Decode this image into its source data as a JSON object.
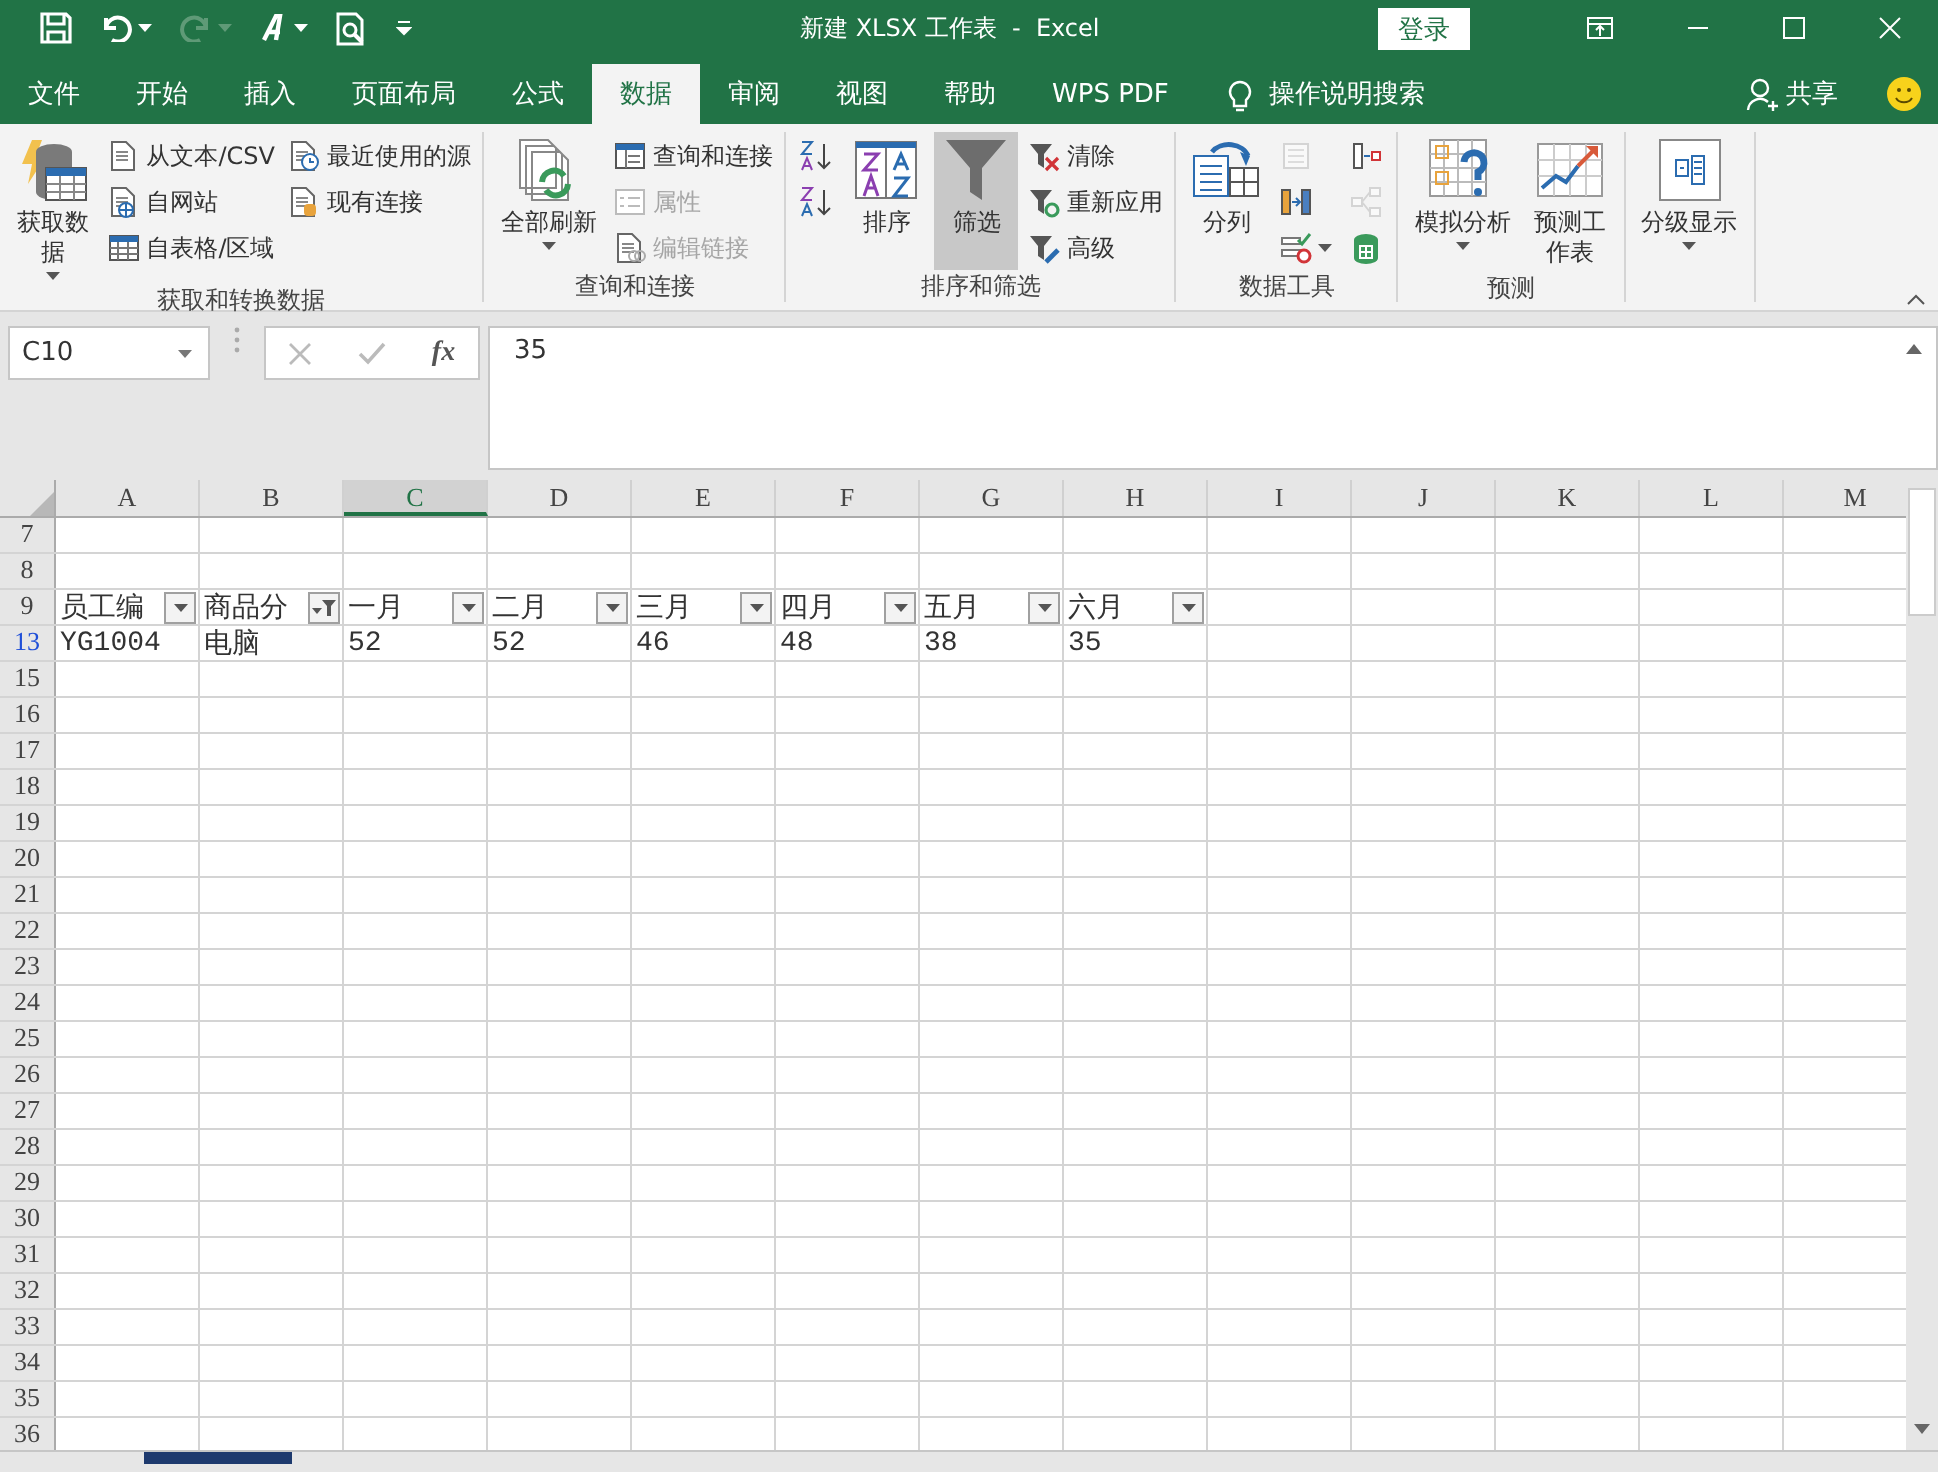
{
  "title_bar": {
    "quick_access": [
      {
        "kind": "save",
        "disabled": false
      },
      {
        "kind": "undo",
        "disabled": false
      },
      {
        "kind": "redo",
        "disabled": true
      },
      {
        "kind": "font",
        "disabled": false
      },
      {
        "kind": "preview",
        "disabled": false
      },
      {
        "kind": "customize",
        "disabled": false
      }
    ],
    "title": "新建 XLSX 工作表  -  Excel",
    "login": "登录"
  },
  "tabs": [
    {
      "label": "文件",
      "selected": false
    },
    {
      "label": "开始",
      "selected": false
    },
    {
      "label": "插入",
      "selected": false
    },
    {
      "label": "页面布局",
      "selected": false
    },
    {
      "label": "公式",
      "selected": false
    },
    {
      "label": "数据",
      "selected": true
    },
    {
      "label": "审阅",
      "selected": false
    },
    {
      "label": "视图",
      "selected": false
    },
    {
      "label": "帮助",
      "selected": false
    },
    {
      "label": "WPS PDF",
      "selected": false
    }
  ],
  "tell_me": "操作说明搜索",
  "share": "共享",
  "ribbon": {
    "groups": [
      {
        "label": "获取和转换数据",
        "items": [
          {
            "kind": "large",
            "label": "获取数据",
            "dropdown": true,
            "disabled": false,
            "pressed": false
          },
          {
            "kind": "small",
            "label": "从文本/CSV",
            "disabled": false
          },
          {
            "kind": "small",
            "label": "自网站",
            "disabled": false
          },
          {
            "kind": "small",
            "label": "自表格/区域",
            "disabled": false
          },
          {
            "kind": "small",
            "label": "最近使用的源",
            "disabled": false
          },
          {
            "kind": "small",
            "label": "现有连接",
            "disabled": false
          }
        ]
      },
      {
        "label": "查询和连接",
        "items": [
          {
            "kind": "large",
            "label": "全部刷新",
            "dropdown": true,
            "disabled": false,
            "pressed": false
          },
          {
            "kind": "small",
            "label": "查询和连接",
            "disabled": false
          },
          {
            "kind": "small",
            "label": "属性",
            "disabled": true
          },
          {
            "kind": "small",
            "label": "编辑链接",
            "disabled": true
          }
        ]
      },
      {
        "label": "排序和筛选",
        "items": [
          {
            "kind": "icon",
            "disabled": false,
            "dropdown": false
          },
          {
            "kind": "icon",
            "disabled": false,
            "dropdown": false
          },
          {
            "kind": "break"
          },
          {
            "kind": "large",
            "label": "排序",
            "dropdown": false,
            "disabled": false,
            "pressed": false
          },
          {
            "kind": "large",
            "label": "筛选",
            "dropdown": false,
            "disabled": false,
            "pressed": true
          },
          {
            "kind": "small",
            "label": "清除",
            "disabled": false
          },
          {
            "kind": "small",
            "label": "重新应用",
            "disabled": false
          },
          {
            "kind": "small",
            "label": "高级",
            "disabled": false
          }
        ]
      },
      {
        "label": "数据工具",
        "items": [
          {
            "kind": "large",
            "label": "分列",
            "dropdown": false,
            "disabled": false,
            "pressed": false
          },
          {
            "kind": "icon",
            "disabled": true,
            "dropdown": false
          },
          {
            "kind": "icon",
            "disabled": false,
            "dropdown": false
          },
          {
            "kind": "icon",
            "disabled": false,
            "dropdown": true
          },
          {
            "kind": "icon",
            "disabled": false,
            "dropdown": false
          },
          {
            "kind": "icon",
            "disabled": true,
            "dropdown": false
          },
          {
            "kind": "icon",
            "disabled": false,
            "dropdown": false
          }
        ]
      },
      {
        "label": "预测",
        "items": [
          {
            "kind": "large",
            "label": "模拟分析",
            "dropdown": true,
            "disabled": false,
            "pressed": false
          },
          {
            "kind": "large",
            "label": "预测工作表",
            "dropdown": false,
            "disabled": false,
            "pressed": false
          }
        ]
      },
      {
        "items": [
          {
            "kind": "large",
            "label": "分级显示",
            "dropdown": true,
            "disabled": false,
            "pressed": false
          }
        ]
      }
    ]
  },
  "formula_bar": {
    "name_box": "C10",
    "cancel_disabled": true,
    "enter_disabled": true,
    "function_label": "fx",
    "value": "35"
  },
  "sheet": {
    "columns": [
      {
        "label": "A",
        "selected": false
      },
      {
        "label": "B",
        "selected": false
      },
      {
        "label": "C",
        "selected": true
      },
      {
        "label": "D",
        "selected": false
      },
      {
        "label": "E",
        "selected": false
      },
      {
        "label": "F",
        "selected": false
      },
      {
        "label": "G",
        "selected": false
      },
      {
        "label": "H",
        "selected": false
      },
      {
        "label": "I",
        "selected": false
      },
      {
        "label": "J",
        "selected": false
      },
      {
        "label": "K",
        "selected": false
      },
      {
        "label": "L",
        "selected": false
      },
      {
        "label": "M",
        "selected": false
      }
    ],
    "rows": [
      {
        "number": "7",
        "filtered": false
      },
      {
        "number": "8",
        "filtered": false
      },
      {
        "number": "9",
        "filtered": false,
        "cells": [
          {
            "text": "员工编",
            "filter_applied": false
          },
          {
            "text": "商品分",
            "filter_applied": true
          },
          {
            "text": "一月",
            "filter_applied": false
          },
          {
            "text": "二月",
            "filter_applied": false
          },
          {
            "text": "三月",
            "filter_applied": false
          },
          {
            "text": "四月",
            "filter_applied": false
          },
          {
            "text": "五月",
            "filter_applied": false
          },
          {
            "text": "六月",
            "filter_applied": false
          }
        ]
      },
      {
        "number": "13",
        "filtered": true,
        "cells": [
          {
            "text": "YG1004"
          },
          {
            "text": "电脑"
          },
          {
            "text": "52"
          },
          {
            "text": "52"
          },
          {
            "text": "46"
          },
          {
            "text": "48"
          },
          {
            "text": "38"
          },
          {
            "text": "35"
          }
        ]
      },
      {
        "number": "15",
        "filtered": false
      },
      {
        "number": "16",
        "filtered": false
      },
      {
        "number": "17",
        "filtered": false
      },
      {
        "number": "18",
        "filtered": false
      },
      {
        "number": "19",
        "filtered": false
      },
      {
        "number": "20",
        "filtered": false
      },
      {
        "number": "21",
        "filtered": false
      },
      {
        "number": "22",
        "filtered": false
      },
      {
        "number": "23",
        "filtered": false
      },
      {
        "number": "24",
        "filtered": false
      },
      {
        "number": "25",
        "filtered": false
      },
      {
        "number": "26",
        "filtered": false
      },
      {
        "number": "27",
        "filtered": false
      },
      {
        "number": "28",
        "filtered": false
      },
      {
        "number": "29",
        "filtered": false
      },
      {
        "number": "30",
        "filtered": false
      },
      {
        "number": "31",
        "filtered": false
      },
      {
        "number": "32",
        "filtered": false
      },
      {
        "number": "33",
        "filtered": false
      },
      {
        "number": "34",
        "filtered": false
      },
      {
        "number": "35",
        "filtered": false
      },
      {
        "number": "36",
        "filtered": false
      }
    ]
  }
}
